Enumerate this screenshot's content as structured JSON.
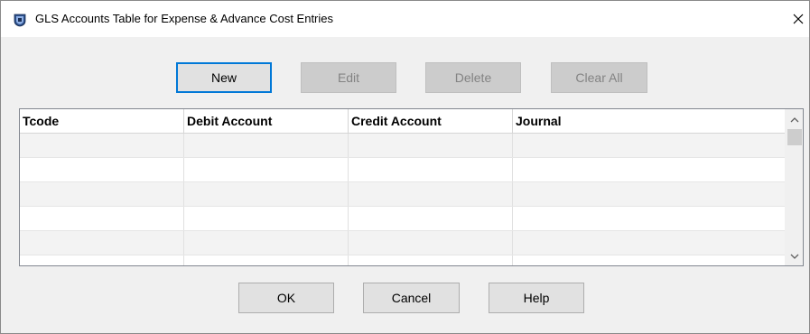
{
  "window": {
    "title": "GLS Accounts Table for Expense & Advance Cost Entries",
    "icon": "app-shield-icon",
    "close_icon": "close-icon"
  },
  "toolbar": {
    "new_label": "New",
    "edit_label": "Edit",
    "delete_label": "Delete",
    "clear_all_label": "Clear All"
  },
  "table": {
    "columns": [
      {
        "label": "Tcode"
      },
      {
        "label": "Debit Account"
      },
      {
        "label": "Credit Account"
      },
      {
        "label": "Journal"
      }
    ],
    "rows": [
      [
        "",
        "",
        "",
        ""
      ],
      [
        "",
        "",
        "",
        ""
      ],
      [
        "",
        "",
        "",
        ""
      ],
      [
        "",
        "",
        "",
        ""
      ],
      [
        "",
        "",
        "",
        ""
      ],
      [
        "",
        "",
        "",
        ""
      ]
    ]
  },
  "footer": {
    "ok_label": "OK",
    "cancel_label": "Cancel",
    "help_label": "Help"
  },
  "colors": {
    "accent": "#0078d7",
    "disabled_text": "#838383",
    "alt_row": "#f3f3f3"
  }
}
